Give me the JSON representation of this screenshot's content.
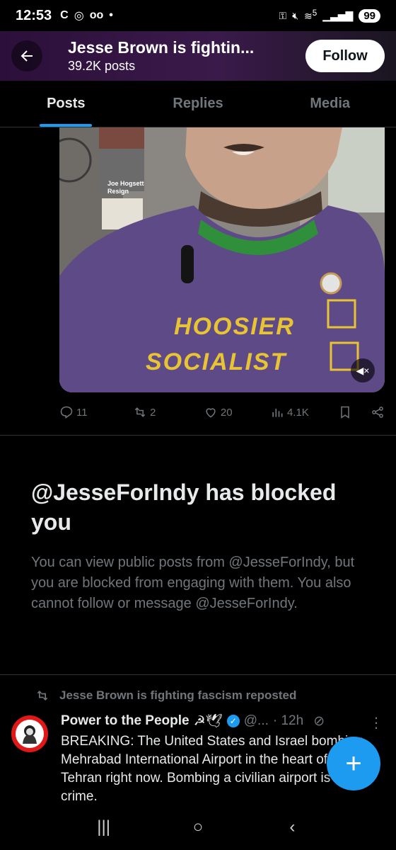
{
  "status_bar": {
    "time": "12:53",
    "battery": "99",
    "signal_label": "5"
  },
  "header": {
    "title": "Jesse Brown is fightin...",
    "post_count": "39.2K posts",
    "follow_label": "Follow"
  },
  "tabs": [
    {
      "label": "Posts",
      "active": true
    },
    {
      "label": "Replies",
      "active": false
    },
    {
      "label": "Media",
      "active": false
    }
  ],
  "video": {
    "sign_line1": "Joe Hogsett",
    "sign_line2": "Resign",
    "shirt_line1": "HOOSIER",
    "shirt_line2": "SOCIALIST"
  },
  "post_actions": {
    "replies": "11",
    "reposts": "2",
    "likes": "20",
    "views": "4.1K"
  },
  "blocked": {
    "title": "@JesseForIndy has blocked you",
    "body": "You can view public posts from @JesseForIndy, but you are blocked from engaging with them. You also cannot follow or message @JesseForIndy."
  },
  "repost": {
    "label": "Jesse Brown is fighting fascism reposted"
  },
  "post": {
    "name": "Power to the People",
    "emoji": "☭🕊",
    "handle": "@...",
    "time": "· 12h",
    "text": "BREAKING: The United States and Israel bombing Mehrabad International Airport in the heart of Tehran right now. Bombing a civilian airport is a war crime."
  },
  "colors": {
    "accent": "#1d9bf0",
    "background": "#000000",
    "muted": "#71767b"
  }
}
